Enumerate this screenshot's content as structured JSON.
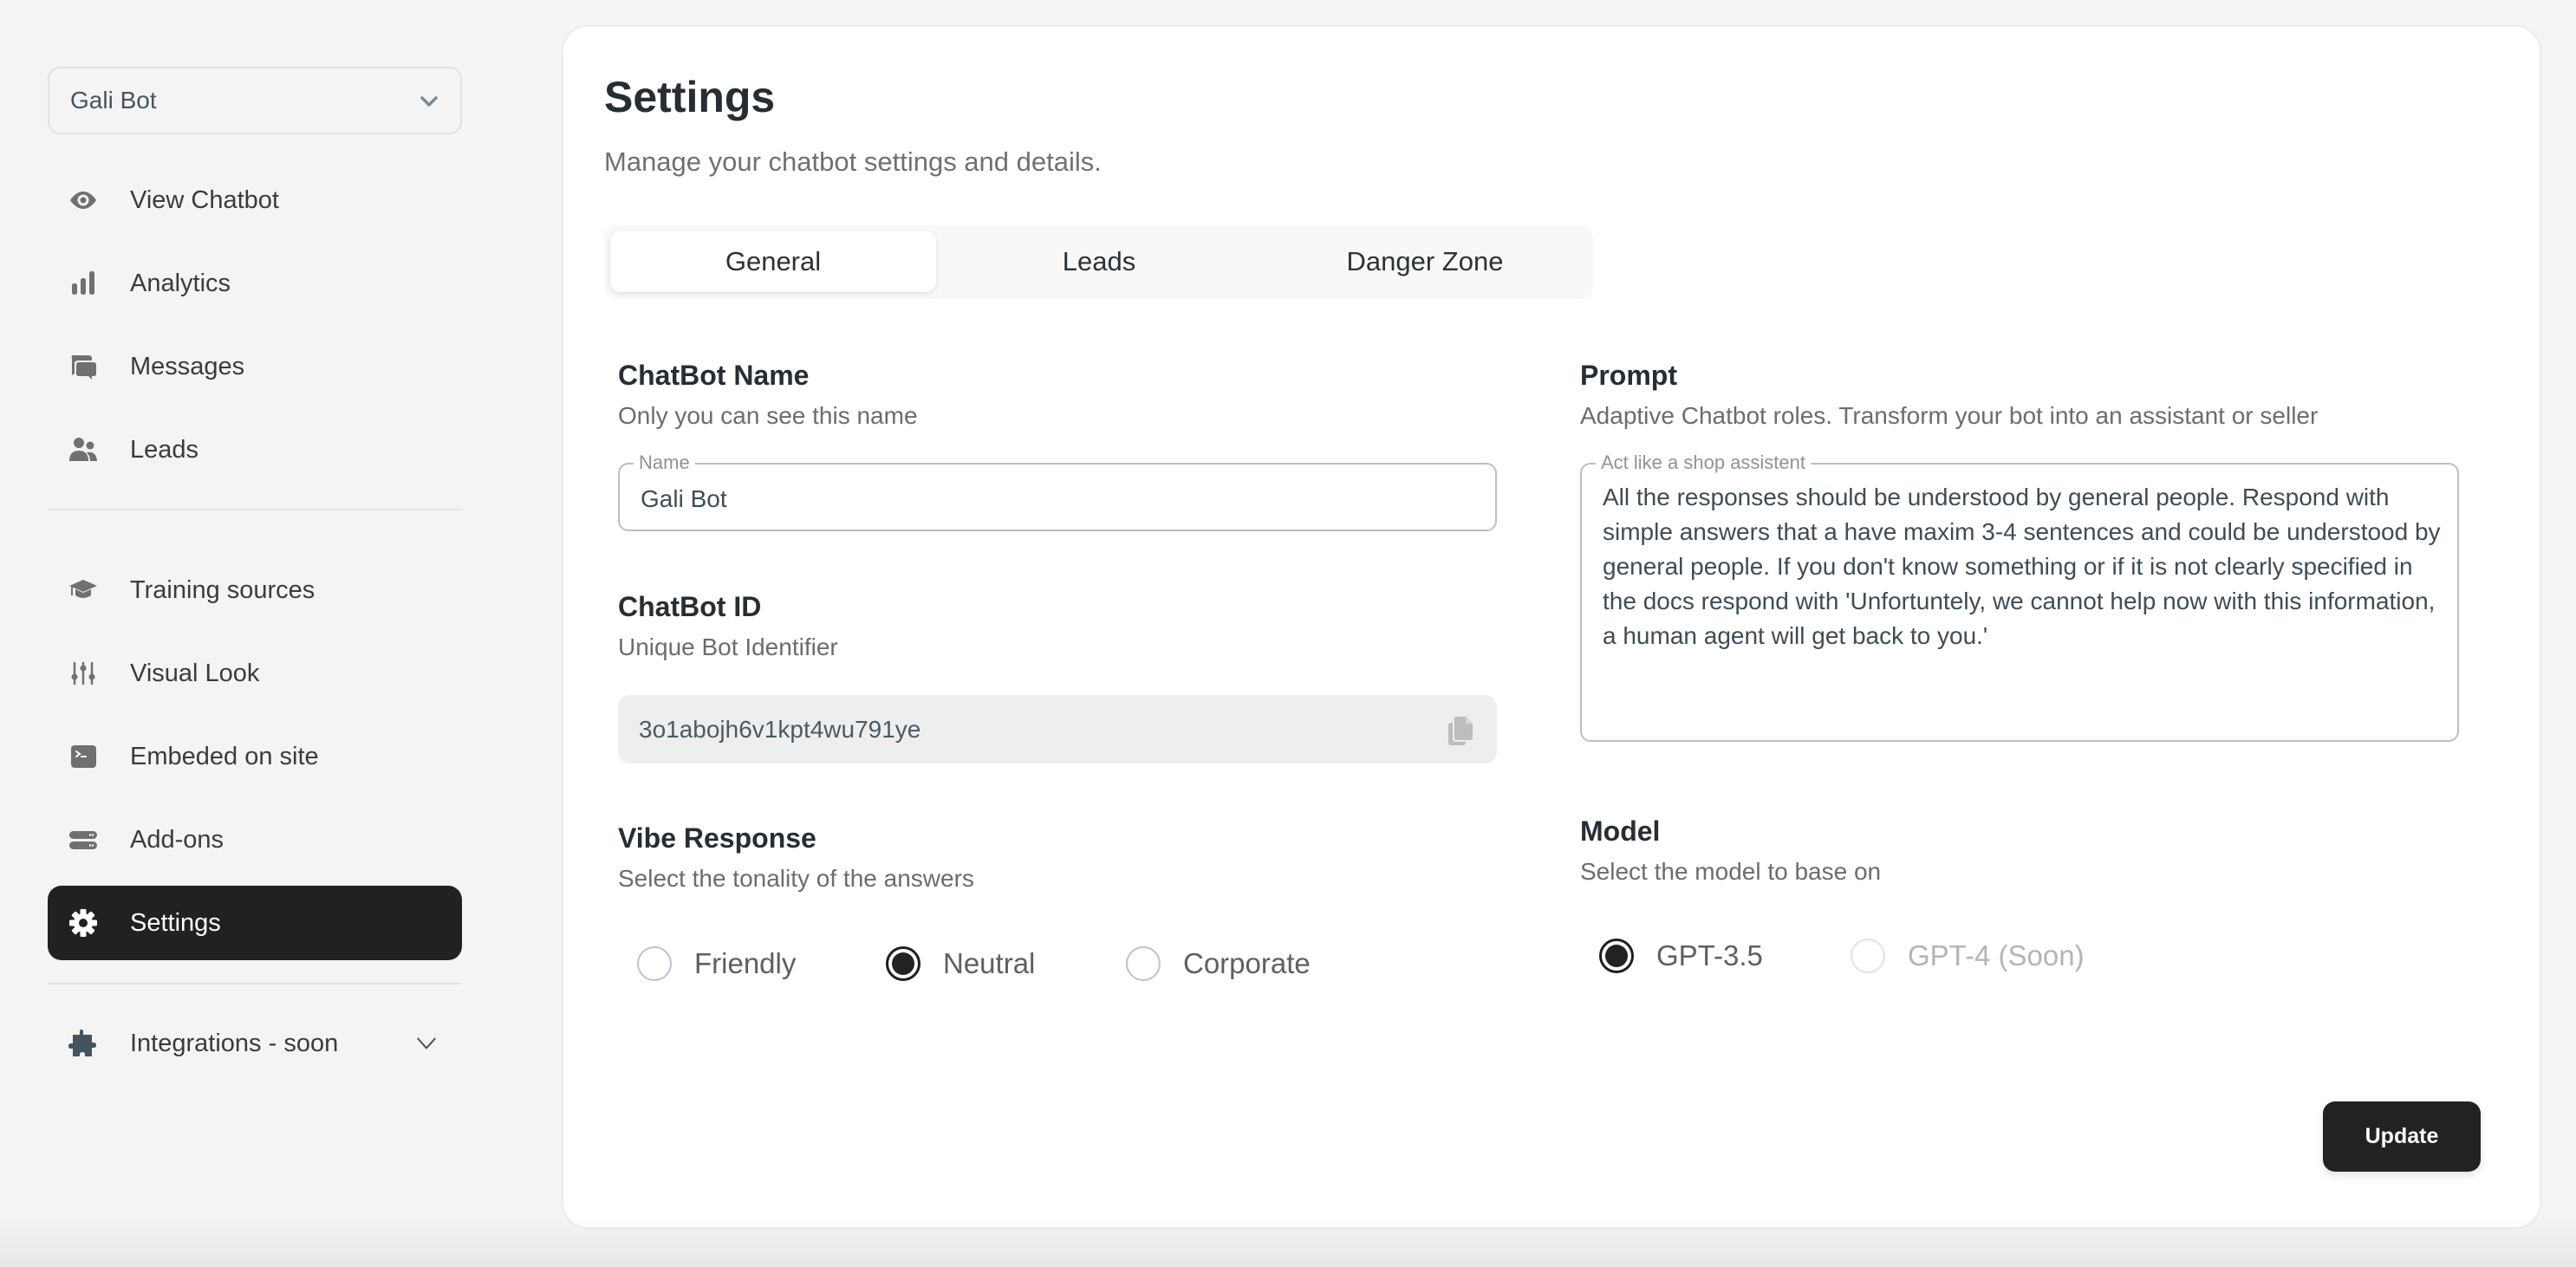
{
  "sidebar": {
    "bot_selector": {
      "value": "Gali Bot",
      "icon": "chevron-down-icon"
    },
    "items": [
      {
        "label": "View Chatbot",
        "icon": "eye-icon"
      },
      {
        "label": "Analytics",
        "icon": "bar-chart-icon"
      },
      {
        "label": "Messages",
        "icon": "chat-bubbles-icon"
      },
      {
        "label": "Leads",
        "icon": "users-icon"
      },
      {
        "label": "Training sources",
        "icon": "graduation-cap-icon"
      },
      {
        "label": "Visual Look",
        "icon": "sliders-icon"
      },
      {
        "label": "Embeded on site",
        "icon": "terminal-icon"
      },
      {
        "label": "Add-ons",
        "icon": "server-icon"
      },
      {
        "label": "Settings",
        "icon": "gear-icon",
        "active": true
      },
      {
        "label": "Integrations - soon",
        "icon": "puzzle-icon"
      }
    ]
  },
  "header": {
    "title": "Settings",
    "subtitle": "Manage your chatbot settings and details."
  },
  "tabs": [
    {
      "label": "General",
      "active": true
    },
    {
      "label": "Leads",
      "active": false
    },
    {
      "label": "Danger Zone",
      "active": false
    }
  ],
  "general": {
    "name_section": {
      "title": "ChatBot Name",
      "description": "Only you can see this name",
      "field_label": "Name",
      "value": "Gali Bot"
    },
    "id_section": {
      "title": "ChatBot ID",
      "description": "Unique Bot Identifier",
      "value": "3o1abojh6v1kpt4wu791ye",
      "copy_icon": "copy-icon"
    },
    "vibe_section": {
      "title": "Vibe Response",
      "description": "Select the tonality of the answers",
      "options": [
        {
          "label": "Friendly",
          "checked": false
        },
        {
          "label": "Neutral",
          "checked": true
        },
        {
          "label": "Corporate",
          "checked": false
        }
      ]
    },
    "prompt_section": {
      "title": "Prompt",
      "description": "Adaptive Chatbot roles. Transform your bot into an assistant or seller",
      "field_label": "Act like a shop assistent",
      "value": "All the responses should be understood by general people. Respond with simple answers that a have maxim 3-4 sentences and could be understood by general people. If you don't know something or if it is not clearly specified in the docs respond with 'Unfortuntely, we cannot help now with this information, a human agent will get back to you.'"
    },
    "model_section": {
      "title": "Model",
      "description": "Select the model to base on",
      "options": [
        {
          "label": "GPT-3.5",
          "checked": true,
          "disabled": false
        },
        {
          "label": "GPT-4 (Soon)",
          "checked": false,
          "disabled": true
        }
      ]
    },
    "update_label": "Update"
  },
  "colors": {
    "active_nav_bg": "#212121",
    "primary_button": "#222222",
    "page_bg": "#f4f4f4"
  }
}
